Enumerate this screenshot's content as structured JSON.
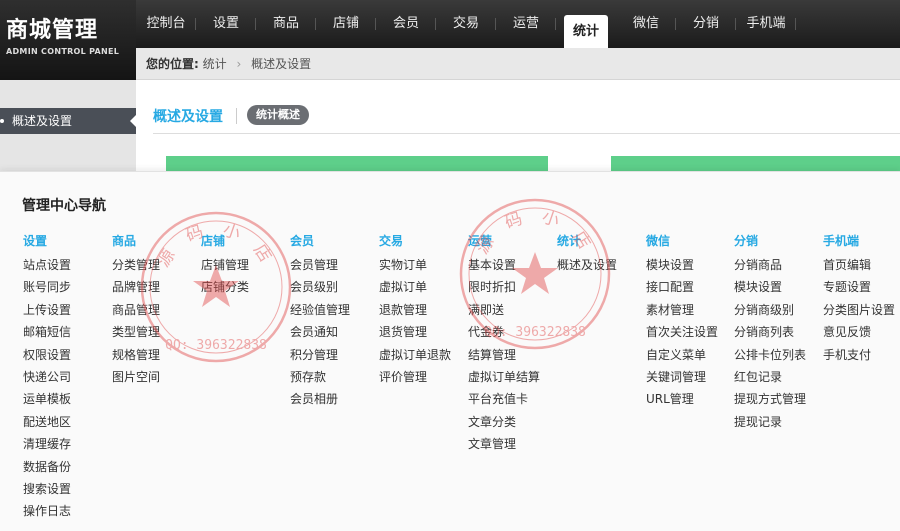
{
  "logo": {
    "title": "商城管理",
    "subtitle": "ADMIN CONTROL PANEL"
  },
  "nav": [
    "控制台",
    "设置",
    "商品",
    "店铺",
    "会员",
    "交易",
    "运营",
    "统计",
    "微信",
    "分销",
    "手机端"
  ],
  "nav_active": "统计",
  "breadcrumb": {
    "prefix": "您的位置:",
    "items": [
      "统计",
      "概述及设置"
    ]
  },
  "sidebar": {
    "item": "概述及设置"
  },
  "main": {
    "title": "概述及设置",
    "pill": "统计概述"
  },
  "overlay": {
    "title": "管理中心导航",
    "columns": [
      {
        "head": "设置",
        "items": [
          "站点设置",
          "账号同步",
          "上传设置",
          "邮箱短信",
          "权限设置",
          "快递公司",
          "运单模板",
          "配送地区",
          "清理缓存",
          "数据备份",
          "搜索设置",
          "操作日志"
        ]
      },
      {
        "head": "商品",
        "items": [
          "分类管理",
          "品牌管理",
          "商品管理",
          "类型管理",
          "规格管理",
          "图片空间"
        ]
      },
      {
        "head": "店铺",
        "items": [
          "店铺管理",
          "店铺分类"
        ]
      },
      {
        "head": "会员",
        "items": [
          "会员管理",
          "会员级别",
          "经验值管理",
          "会员通知",
          "积分管理",
          "预存款",
          "会员相册"
        ]
      },
      {
        "head": "交易",
        "items": [
          "实物订单",
          "虚拟订单",
          "退款管理",
          "退货管理",
          "虚拟订单退款",
          "评价管理"
        ]
      },
      {
        "head": "运营",
        "items": [
          "基本设置",
          "限时折扣",
          "满即送",
          "代金券",
          "结算管理",
          "虚拟订单结算",
          "平台充值卡",
          "文章分类",
          "文章管理"
        ]
      },
      {
        "head": "统计",
        "items": [
          "概述及设置"
        ]
      },
      {
        "head": "微信",
        "items": [
          "模块设置",
          "接口配置",
          "素材管理",
          "首次关注设置",
          "自定义菜单",
          "关键词管理",
          "URL管理"
        ]
      },
      {
        "head": "分销",
        "items": [
          "分销商品",
          "模块设置",
          "分销商级别",
          "分销商列表",
          "公排卡位列表",
          "红包记录",
          "提现方式管理",
          "提现记录"
        ]
      },
      {
        "head": "手机端",
        "items": [
          "首页编辑",
          "专题设置",
          "分类图片设置",
          "意见反馈",
          "手机支付"
        ]
      }
    ]
  },
  "watermark": {
    "top_text": "源 码 小 店",
    "qq": "QQ: 396322838"
  },
  "colors": {
    "accent": "#27a9e3",
    "bar_green": "#5ecf8a",
    "seal_red": "#e04848"
  }
}
